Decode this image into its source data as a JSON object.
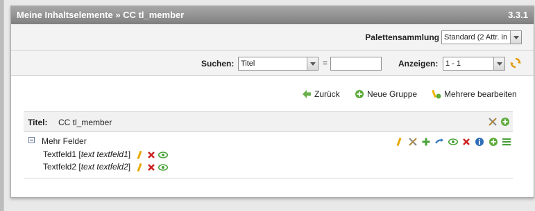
{
  "header": {
    "title": "Meine Inhaltselemente » CC tl_member",
    "version": "3.3.1"
  },
  "palette": {
    "label": "Palettensammlung",
    "selected": "Standard (2 Attr. in"
  },
  "filter": {
    "search_label": "Suchen:",
    "search_field": "Titel",
    "equals": "=",
    "search_value": "",
    "show_label": "Anzeigen:",
    "show_value": "1 - 1"
  },
  "actions": {
    "back": "Zurück",
    "new_group": "Neue Gruppe",
    "edit_multiple": "Mehrere bearbeiten"
  },
  "record": {
    "title_label": "Titel:",
    "title_value": "CC tl_member"
  },
  "group": {
    "label": "Mehr Felder",
    "fields": [
      {
        "name": "Textfeld1",
        "type": "text textfeld1"
      },
      {
        "name": "Textfeld2",
        "type": "text textfeld2"
      }
    ]
  },
  "colors": {
    "header_bg": "#8f8f8f",
    "accent_green": "#4aa33a",
    "delete_red": "#cc2222"
  }
}
